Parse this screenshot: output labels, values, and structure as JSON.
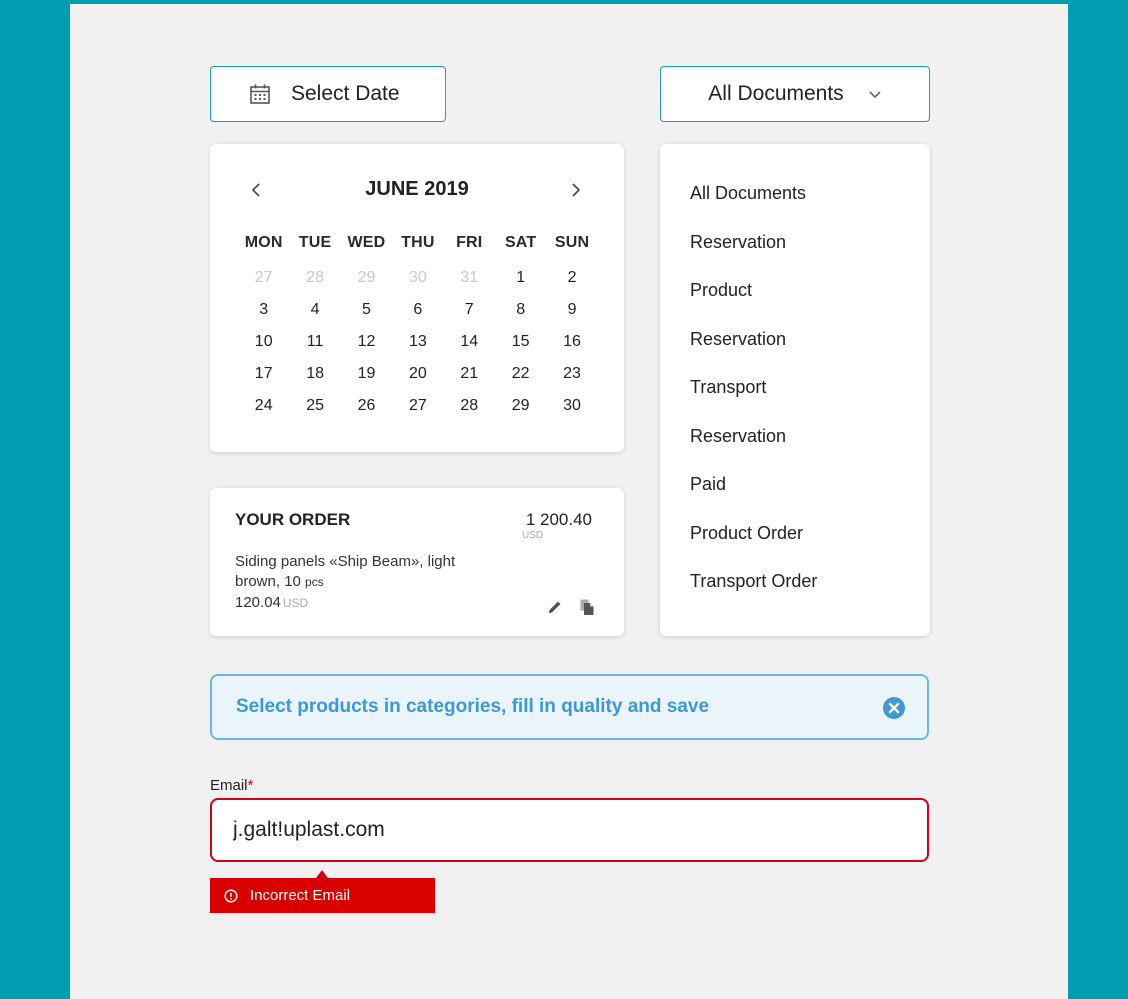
{
  "date_button": {
    "label": "Select Date",
    "icon": "calendar-icon"
  },
  "doc_button": {
    "label": "All Documents",
    "icon": "chevron-down-icon"
  },
  "calendar": {
    "month": "JUNE 2019",
    "weekdays": [
      "MON",
      "TUE",
      "WED",
      "THU",
      "FRI",
      "SAT",
      "SUN"
    ],
    "weeks": [
      [
        "27",
        "28",
        "29",
        "30",
        "31",
        "1",
        "2"
      ],
      [
        "3",
        "4",
        "5",
        "6",
        "7",
        "8",
        "9"
      ],
      [
        "10",
        "11",
        "12",
        "13",
        "14",
        "15",
        "16"
      ],
      [
        "17",
        "18",
        "19",
        "20",
        "21",
        "22",
        "23"
      ],
      [
        "24",
        "25",
        "26",
        "27",
        "28",
        "29",
        "30"
      ]
    ],
    "muted_color": "#c8c8c8"
  },
  "order": {
    "title": "YOUR ORDER",
    "total": "1 200.40",
    "total_currency": "USD",
    "description_main": "Siding panels «Ship Beam», light brown, 10",
    "description_unit": "pcs",
    "price": "120.04",
    "price_currency": "USD"
  },
  "doc_list": [
    "All Documents",
    "Reservation",
    "Product",
    "Reservation",
    "Transport",
    "Reservation",
    "Paid",
    "Product Order",
    "Transport Order"
  ],
  "notice": {
    "text": "Select products in categories, fill in quality and save"
  },
  "email": {
    "label": "Email",
    "required_mark": "*",
    "value": "j.galt!uplast.com",
    "error": "Incorrect Email"
  },
  "colors": {
    "background": "#009db0",
    "accent_border": "#1f9fb5",
    "info_blue": "#3d98d4",
    "error_red": "#d0021b"
  }
}
